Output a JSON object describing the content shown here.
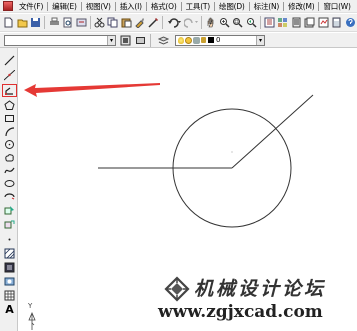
{
  "menu": {
    "items": [
      "文件(F)",
      "编辑(E)",
      "视图(V)",
      "插入(I)",
      "格式(O)",
      "工具(T)",
      "绘图(D)",
      "标注(N)",
      "修改(M)",
      "窗口(W)"
    ]
  },
  "toolbar2": {
    "layer_value": "0"
  },
  "drawbar": {
    "text_tool": "A"
  },
  "watermark": {
    "title": "机械设计论坛",
    "url": "www.zgjxcad.com"
  },
  "ucs": {
    "y_label": "Y"
  },
  "colors": {
    "annotation_arrow": "#e53935",
    "drawing_lines": "#333333",
    "toolbar_bg": "#f0f0f0"
  }
}
